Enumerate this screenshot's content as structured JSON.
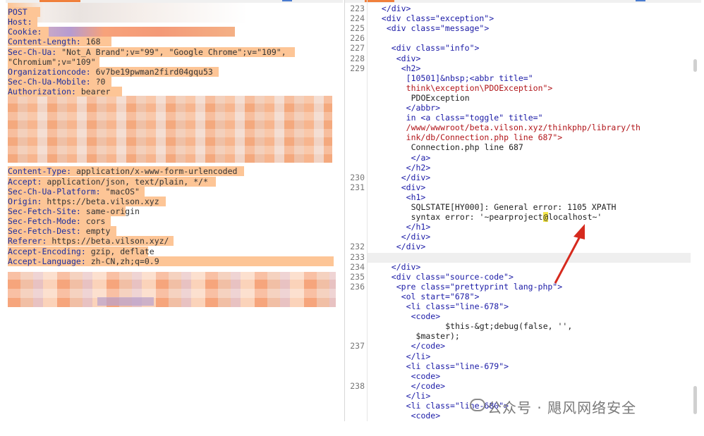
{
  "left_pane": {
    "lines": [
      {
        "name": "POST",
        "value": ""
      },
      {
        "name": "Host:",
        "value": ""
      },
      {
        "name": "Cookie:",
        "value": ""
      },
      {
        "name": "Content-Length:",
        "value": " 168"
      },
      {
        "name": "Sec-Ch-Ua:",
        "value": " \"Not_A Brand\";v=\"99\", \"Google Chrome\";v=\"109\","
      },
      {
        "name": "",
        "value": "\"Chromium\";v=\"109\""
      },
      {
        "name": "Organizationcode:",
        "value": " 6v7be19pwman2fird04gqu53"
      },
      {
        "name": "Sec-Ch-Ua-Mobile:",
        "value": " ?0"
      },
      {
        "name": "Authorization:",
        "value": " bearer"
      },
      {
        "name": "Content-Type:",
        "value": " application/x-www-form-urlencoded"
      },
      {
        "name": "Accept:",
        "value": " application/json, text/plain, */*"
      },
      {
        "name": "Sec-Ch-Ua-Platform:",
        "value": " \"macOS\""
      },
      {
        "name": "Origin:",
        "value": " https://beta.vilson.xyz"
      },
      {
        "name": "Sec-Fetch-Site:",
        "value": " same-origin"
      },
      {
        "name": "Sec-Fetch-Mode:",
        "value": " cors"
      },
      {
        "name": "Sec-Fetch-Dest:",
        "value": " empty"
      },
      {
        "name": "Referer:",
        "value": " https://beta.vilson.xyz/"
      },
      {
        "name": "Accept-Encoding:",
        "value": " gzip, deflate"
      },
      {
        "name": "Accept-Language:",
        "value": " zh-CN,zh;q=0.9"
      }
    ]
  },
  "right_pane": {
    "line_numbers": [
      "223",
      "224",
      "225",
      "226",
      "227",
      "228",
      "229",
      "230",
      "231",
      "232",
      "233",
      "234",
      "235",
      "236",
      "237",
      "238"
    ],
    "code": [
      "</div>",
      "<div class=\"exception\">",
      "<div class=\"message\">",
      "",
      "<div class=\"info\">",
      "<div>",
      "<h2>",
      "[10501]&nbsp;<abbr title=\"",
      "think\\exception\\PDOException\">",
      "PDOException",
      "</abbr>",
      "in <a class=\"toggle\" title=\"",
      "/www/wwwroot/beta.vilson.xyz/thinkphp/library/th",
      "ink/db/Connection.php line 687\">",
      "Connection.php line 687",
      "</a>",
      "</h2>",
      "</div>",
      "<div>",
      "<h1>",
      "SQLSTATE[HY000]: General error: 1105 XPATH",
      "syntax error: '~pearproject",
      "@",
      "localhost~'",
      "</h1>",
      "</div>",
      "</div>",
      "",
      "</div>",
      "<div class=\"source-code\">",
      "<pre class=\"prettyprint lang-php\">",
      "<ol start=\"678\">",
      "<li class=\"line-678\">",
      "<code>",
      "$this-&gt;debug(false, '',",
      "$master);",
      "</code>",
      "</li>",
      "<li class=\"line-679\">",
      "<code>",
      "</code>",
      "</li>",
      "<li class=\"line-680\">",
      "<code>"
    ]
  },
  "watermark": {
    "text": "公众号 · 飓风网络安全"
  },
  "colors": {
    "highlight": "#fdc596",
    "tag": "#1a1aa6",
    "string": "#b1151a",
    "arrow": "#d62a1e",
    "accent": "#f0803c"
  }
}
